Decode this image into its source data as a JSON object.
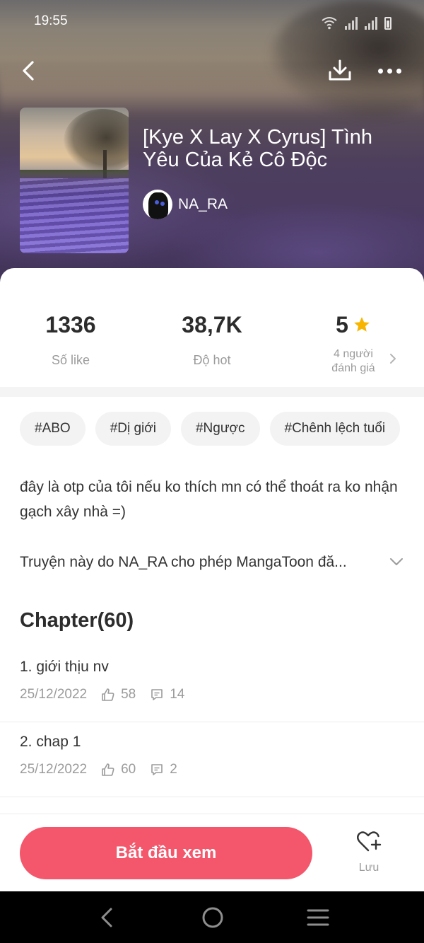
{
  "status_bar": {
    "time": "19:55"
  },
  "story": {
    "title": "[Kye X Lay X Cyrus] Tình Yêu Của Kẻ Cô Độc",
    "author": "NA_RA"
  },
  "stats": {
    "likes": {
      "value": "1336",
      "label": "Số like"
    },
    "hot": {
      "value": "38,7K",
      "label": "Độ hot"
    },
    "rating": {
      "value": "5",
      "label_line1": "4 người",
      "label_line2": "đánh giá"
    }
  },
  "tags": [
    "#ABO",
    "#Dị giới",
    "#Ngược",
    "#Chênh lệch tuổi"
  ],
  "description": "đây là otp của tôi nếu ko thích mn có thể thoát ra ko nhận gạch xây nhà =)",
  "permission_note": "Truyện này do NA_RA cho phép MangaToon đă...",
  "chapters": {
    "heading": "Chapter(60)",
    "items": [
      {
        "title": "1. giới thịu nv",
        "date": "25/12/2022",
        "likes": "58",
        "comments": "14"
      },
      {
        "title": "2. chap 1",
        "date": "25/12/2022",
        "likes": "60",
        "comments": "2"
      }
    ]
  },
  "actions": {
    "start_label": "Bắt đầu xem",
    "save_label": "Lưu"
  },
  "icons": {
    "back": "chevron-left-icon",
    "download": "download-icon",
    "more": "more-dots-icon",
    "star": "star-icon",
    "like": "thumbs-up-icon",
    "comment": "comment-icon",
    "save": "heart-plus-icon"
  },
  "colors": {
    "accent": "#f4566b",
    "star": "#f7b500",
    "muted_text": "#9b9b9b"
  }
}
